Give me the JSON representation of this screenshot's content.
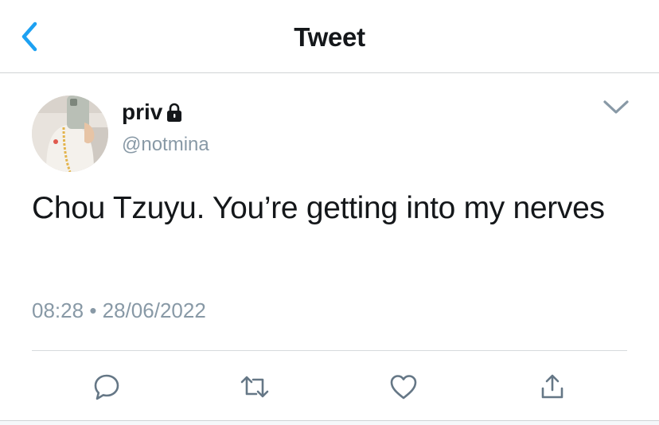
{
  "header": {
    "title": "Tweet",
    "back_icon": "chevron-left-icon",
    "accent": "#1da1f2"
  },
  "tweet": {
    "author": {
      "display_name": "priv",
      "handle": "@notmina",
      "protected_icon": "lock-icon"
    },
    "text": "Chou Tzuyu. You’re getting into my nerves",
    "time": "08:28",
    "separator": "•",
    "date": "28/06/2022"
  },
  "actions": [
    {
      "icon": "reply-icon"
    },
    {
      "icon": "retweet-icon"
    },
    {
      "icon": "like-icon"
    },
    {
      "icon": "share-icon"
    }
  ],
  "colors": {
    "text": "#14171a",
    "secondary": "#8899a6",
    "icon": "#657786",
    "divider": "#d7dadd"
  }
}
